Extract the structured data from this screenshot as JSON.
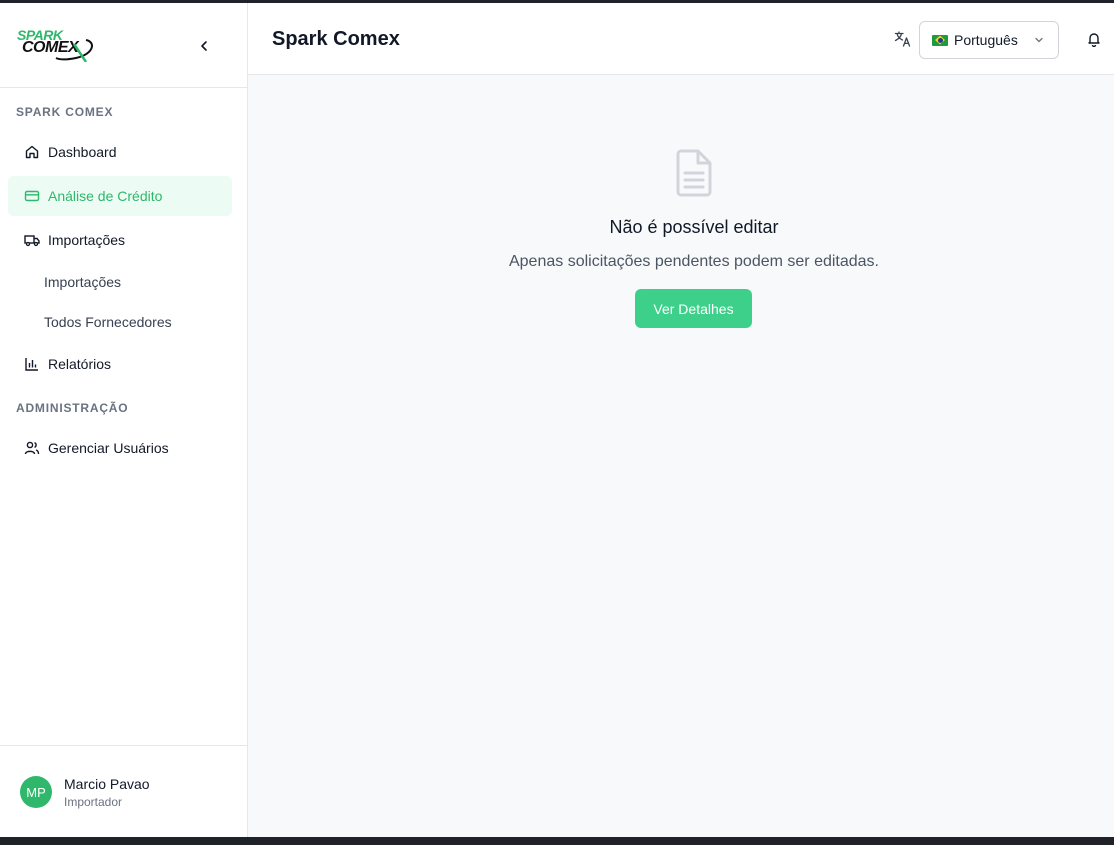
{
  "logo": {
    "line1": "SPARK",
    "line2": "COMEX"
  },
  "sidebar": {
    "section_main": "SPARK COMEX",
    "items": [
      {
        "label": "Dashboard",
        "icon": "home-icon"
      },
      {
        "label": "Análise de Crédito",
        "icon": "credit-card-icon",
        "active": true
      },
      {
        "label": "Importações",
        "icon": "truck-icon"
      }
    ],
    "sub_items": [
      {
        "label": "Importações"
      },
      {
        "label": "Todos Fornecedores"
      }
    ],
    "reports": {
      "label": "Relatórios",
      "icon": "bar-chart-icon"
    },
    "section_admin": "ADMINISTRAÇÃO",
    "admin_items": [
      {
        "label": "Gerenciar Usuários",
        "icon": "users-icon"
      }
    ],
    "user": {
      "initials": "MP",
      "name": "Marcio Pavao",
      "role": "Importador"
    }
  },
  "header": {
    "title": "Spark Comex",
    "language": {
      "selected": "Português",
      "flag": "brazil-flag-icon"
    }
  },
  "main": {
    "empty_state": {
      "icon": "document-icon",
      "title": "Não é possível editar",
      "description": "Apenas solicitações pendentes podem ser editadas.",
      "button_label": "Ver Detalhes"
    }
  },
  "colors": {
    "accent": "#2fb86b",
    "accent_bg": "#ecfbf3",
    "button": "#3dd08a"
  }
}
